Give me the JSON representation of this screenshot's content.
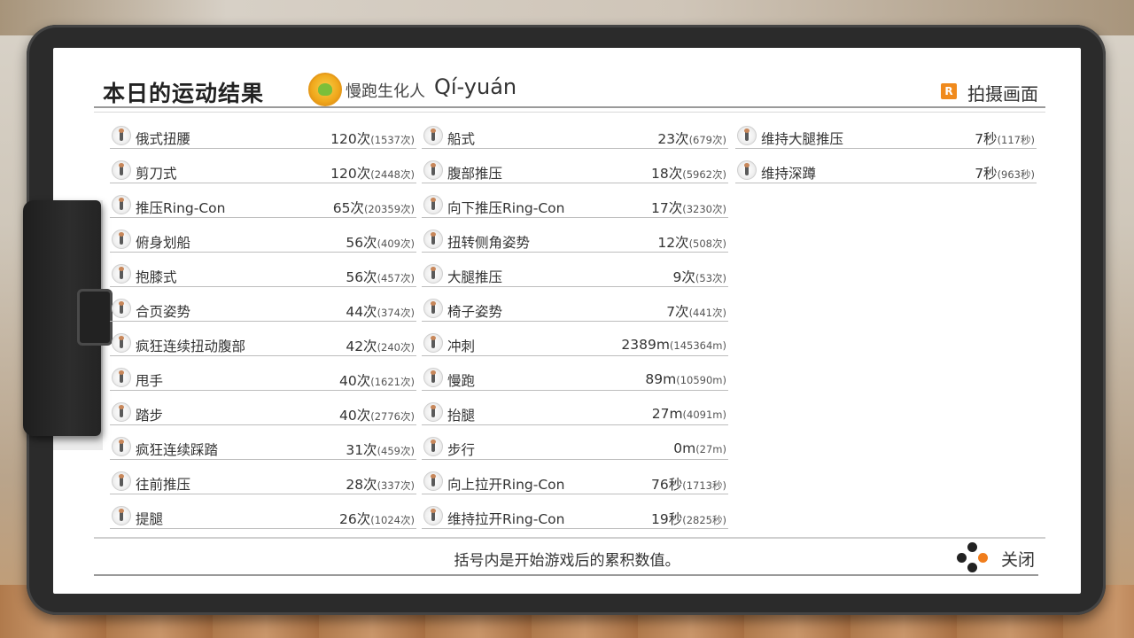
{
  "header": {
    "title": "本日的运动结果",
    "player_title": "慢跑生化人",
    "player_name": "Qí-yuán",
    "capture_badge": "R",
    "capture_label": "拍摄画面"
  },
  "columns": [
    [
      {
        "name": "俄式扭腰",
        "value": "120次",
        "total": "(1537次)"
      },
      {
        "name": "剪刀式",
        "value": "120次",
        "total": "(2448次)"
      },
      {
        "name": "推压Ring-Con",
        "value": "65次",
        "total": "(20359次)"
      },
      {
        "name": "俯身划船",
        "value": "56次",
        "total": "(409次)"
      },
      {
        "name": "抱膝式",
        "value": "56次",
        "total": "(457次)"
      },
      {
        "name": "合页姿势",
        "value": "44次",
        "total": "(374次)"
      },
      {
        "name": "疯狂连续扭动腹部",
        "value": "42次",
        "total": "(240次)"
      },
      {
        "name": "甩手",
        "value": "40次",
        "total": "(1621次)"
      },
      {
        "name": "踏步",
        "value": "40次",
        "total": "(2776次)"
      },
      {
        "name": "疯狂连续踩踏",
        "value": "31次",
        "total": "(459次)"
      },
      {
        "name": "往前推压",
        "value": "28次",
        "total": "(337次)"
      },
      {
        "name": "提腿",
        "value": "26次",
        "total": "(1024次)"
      }
    ],
    [
      {
        "name": "船式",
        "value": "23次",
        "total": "(679次)"
      },
      {
        "name": "腹部推压",
        "value": "18次",
        "total": "(5962次)"
      },
      {
        "name": "向下推压Ring-Con",
        "value": "17次",
        "total": "(3230次)"
      },
      {
        "name": "扭转侧角姿势",
        "value": "12次",
        "total": "(508次)"
      },
      {
        "name": "大腿推压",
        "value": "9次",
        "total": "(53次)"
      },
      {
        "name": "椅子姿势",
        "value": "7次",
        "total": "(441次)"
      },
      {
        "name": "冲刺",
        "value": "2389m",
        "total": "(145364m)"
      },
      {
        "name": "慢跑",
        "value": "89m",
        "total": "(10590m)"
      },
      {
        "name": "抬腿",
        "value": "27m",
        "total": "(4091m)"
      },
      {
        "name": "步行",
        "value": "0m",
        "total": "(27m)"
      },
      {
        "name": "向上拉开Ring-Con",
        "value": "76秒",
        "total": "(1713秒)"
      },
      {
        "name": "维持拉开Ring-Con",
        "value": "19秒",
        "total": "(2825秒)"
      }
    ],
    [
      {
        "name": "维持大腿推压",
        "value": "7秒",
        "total": "(117秒)"
      },
      {
        "name": "维持深蹲",
        "value": "7秒",
        "total": "(963秒)"
      }
    ]
  ],
  "footer": {
    "note": "括号内是开始游戏后的累积数值。",
    "close_label": "关闭"
  },
  "colors": {
    "accent": "#f07d1c",
    "frame": "#2b2b2b",
    "paper": "#ffffff"
  },
  "icons": {
    "avatar": "player-avatar-icon",
    "exercise": "exercise-figure-icon",
    "capture": "r-button-icon",
    "close": "controller-buttons-icon"
  }
}
